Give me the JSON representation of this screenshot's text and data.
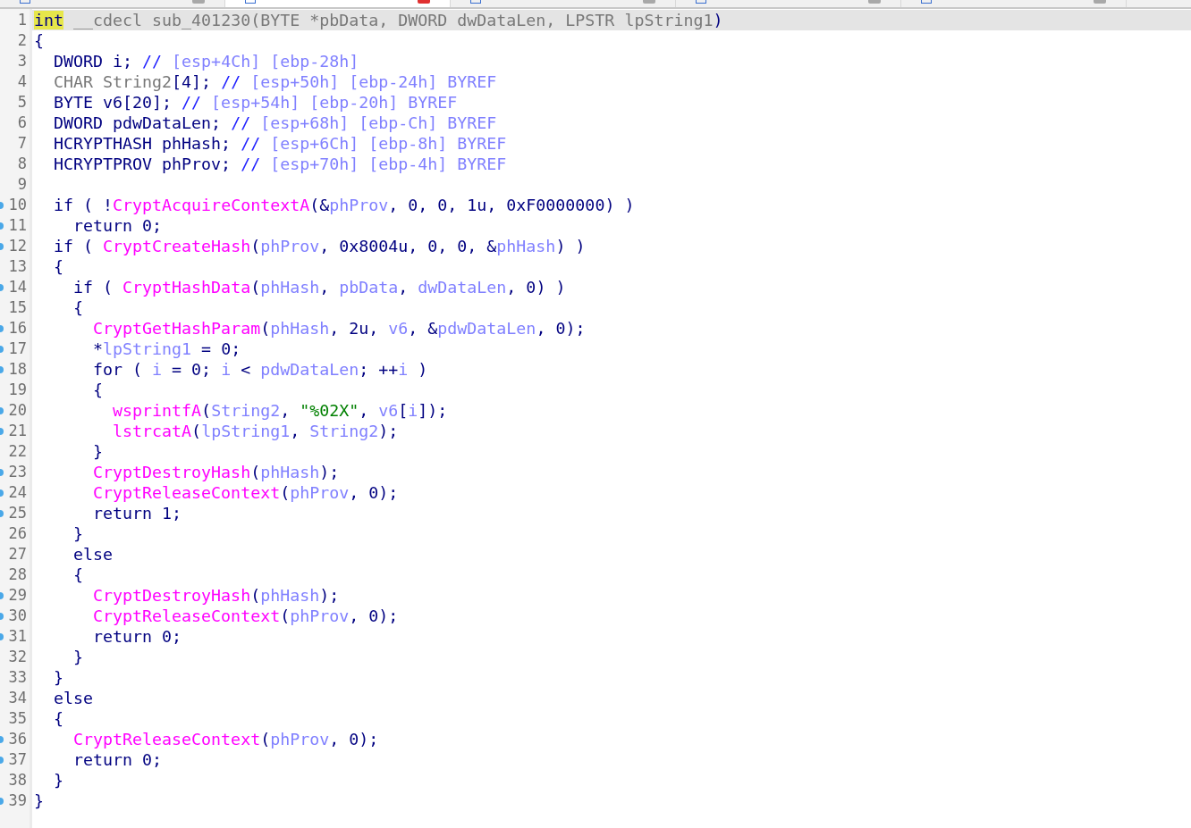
{
  "tabs": [
    {
      "selected": false
    },
    {
      "selected": true
    },
    {
      "selected": false
    },
    {
      "selected": false
    },
    {
      "selected": false
    }
  ],
  "lines": [
    {
      "number": "1",
      "marker": false,
      "selected": true,
      "tokens": [
        {
          "kind": "highlight",
          "text": "int"
        },
        {
          "kind": "dim",
          "text": " __cdecl sub_401230(BYTE *pbData, DWORD dwDataLen, LPSTR lpString1"
        },
        {
          "kind": "code",
          "text": ")"
        }
      ]
    },
    {
      "number": "2",
      "marker": false,
      "selected": false,
      "tokens": [
        {
          "kind": "code",
          "text": "{"
        }
      ]
    },
    {
      "number": "3",
      "marker": false,
      "selected": false,
      "tokens": [
        {
          "kind": "code",
          "text": "  DWORD i; "
        },
        {
          "kind": "comment",
          "text": "//"
        },
        {
          "kind": "var",
          "text": " [esp+4Ch] [ebp-28h]"
        }
      ]
    },
    {
      "number": "4",
      "marker": false,
      "selected": false,
      "tokens": [
        {
          "kind": "dim",
          "text": "  CHAR String2"
        },
        {
          "kind": "code",
          "text": "[4]; "
        },
        {
          "kind": "comment",
          "text": "//"
        },
        {
          "kind": "var",
          "text": " [esp+50h] [ebp-24h] BYREF"
        }
      ]
    },
    {
      "number": "5",
      "marker": false,
      "selected": false,
      "tokens": [
        {
          "kind": "code",
          "text": "  BYTE v6[20]; "
        },
        {
          "kind": "comment",
          "text": "//"
        },
        {
          "kind": "var",
          "text": " [esp+54h] [ebp-20h] BYREF"
        }
      ]
    },
    {
      "number": "6",
      "marker": false,
      "selected": false,
      "tokens": [
        {
          "kind": "code",
          "text": "  DWORD pdwDataLen; "
        },
        {
          "kind": "comment",
          "text": "//"
        },
        {
          "kind": "var",
          "text": " [esp+68h] [ebp-Ch] BYREF"
        }
      ]
    },
    {
      "number": "7",
      "marker": false,
      "selected": false,
      "tokens": [
        {
          "kind": "code",
          "text": "  HCRYPTHASH phHash; "
        },
        {
          "kind": "comment",
          "text": "//"
        },
        {
          "kind": "var",
          "text": " [esp+6Ch] [ebp-8h] BYREF"
        }
      ]
    },
    {
      "number": "8",
      "marker": false,
      "selected": false,
      "tokens": [
        {
          "kind": "code",
          "text": "  HCRYPTPROV phProv; "
        },
        {
          "kind": "comment",
          "text": "//"
        },
        {
          "kind": "var",
          "text": " [esp+70h] [ebp-4h] BYREF"
        }
      ]
    },
    {
      "number": "9",
      "marker": false,
      "selected": false
    },
    {
      "number": "10",
      "marker": true,
      "selected": false,
      "tokens": [
        {
          "kind": "code",
          "text": "  if ( !"
        },
        {
          "kind": "func",
          "text": "CryptAcquireContextA"
        },
        {
          "kind": "code",
          "text": "(&"
        },
        {
          "kind": "var",
          "text": "phProv"
        },
        {
          "kind": "code",
          "text": ", 0, 0, 1u, 0xF0000000) )"
        }
      ]
    },
    {
      "number": "11",
      "marker": true,
      "selected": false,
      "tokens": [
        {
          "kind": "code",
          "text": "    return 0;"
        }
      ]
    },
    {
      "number": "12",
      "marker": true,
      "selected": false,
      "tokens": [
        {
          "kind": "code",
          "text": "  if ( "
        },
        {
          "kind": "func",
          "text": "CryptCreateHash"
        },
        {
          "kind": "code",
          "text": "("
        },
        {
          "kind": "var",
          "text": "phProv"
        },
        {
          "kind": "code",
          "text": ", 0x8004u, 0, 0, &"
        },
        {
          "kind": "var",
          "text": "phHash"
        },
        {
          "kind": "code",
          "text": ") )"
        }
      ]
    },
    {
      "number": "13",
      "marker": false,
      "selected": false,
      "tokens": [
        {
          "kind": "code",
          "text": "  {"
        }
      ]
    },
    {
      "number": "14",
      "marker": true,
      "selected": false,
      "tokens": [
        {
          "kind": "code",
          "text": "    if ( "
        },
        {
          "kind": "func",
          "text": "CryptHashData"
        },
        {
          "kind": "code",
          "text": "("
        },
        {
          "kind": "var",
          "text": "phHash"
        },
        {
          "kind": "code",
          "text": ", "
        },
        {
          "kind": "var",
          "text": "pbData"
        },
        {
          "kind": "code",
          "text": ", "
        },
        {
          "kind": "var",
          "text": "dwDataLen"
        },
        {
          "kind": "code",
          "text": ", 0) )"
        }
      ]
    },
    {
      "number": "15",
      "marker": false,
      "selected": false,
      "tokens": [
        {
          "kind": "code",
          "text": "    {"
        }
      ]
    },
    {
      "number": "16",
      "marker": true,
      "selected": false,
      "tokens": [
        {
          "kind": "func",
          "text": "      CryptGetHashParam"
        },
        {
          "kind": "code",
          "text": "("
        },
        {
          "kind": "var",
          "text": "phHash"
        },
        {
          "kind": "code",
          "text": ", 2u, "
        },
        {
          "kind": "var",
          "text": "v6"
        },
        {
          "kind": "code",
          "text": ", &"
        },
        {
          "kind": "var",
          "text": "pdwDataLen"
        },
        {
          "kind": "code",
          "text": ", 0);"
        }
      ]
    },
    {
      "number": "17",
      "marker": true,
      "selected": false,
      "tokens": [
        {
          "kind": "code",
          "text": "      *"
        },
        {
          "kind": "var",
          "text": "lpString1"
        },
        {
          "kind": "code",
          "text": " = 0;"
        }
      ]
    },
    {
      "number": "18",
      "marker": true,
      "selected": false,
      "tokens": [
        {
          "kind": "code",
          "text": "      for ( "
        },
        {
          "kind": "var",
          "text": "i"
        },
        {
          "kind": "code",
          "text": " = 0; "
        },
        {
          "kind": "var",
          "text": "i"
        },
        {
          "kind": "code",
          "text": " < "
        },
        {
          "kind": "var",
          "text": "pdwDataLen"
        },
        {
          "kind": "code",
          "text": "; ++"
        },
        {
          "kind": "var",
          "text": "i"
        },
        {
          "kind": "code",
          "text": " )"
        }
      ]
    },
    {
      "number": "19",
      "marker": false,
      "selected": false,
      "tokens": [
        {
          "kind": "code",
          "text": "      {"
        }
      ]
    },
    {
      "number": "20",
      "marker": true,
      "selected": false,
      "tokens": [
        {
          "kind": "func",
          "text": "        wsprintfA"
        },
        {
          "kind": "code",
          "text": "("
        },
        {
          "kind": "var",
          "text": "String2"
        },
        {
          "kind": "code",
          "text": ", "
        },
        {
          "kind": "str",
          "text": "\"%02X\""
        },
        {
          "kind": "code",
          "text": ", "
        },
        {
          "kind": "var",
          "text": "v6"
        },
        {
          "kind": "code",
          "text": "["
        },
        {
          "kind": "var",
          "text": "i"
        },
        {
          "kind": "code",
          "text": "]);"
        }
      ]
    },
    {
      "number": "21",
      "marker": true,
      "selected": false,
      "tokens": [
        {
          "kind": "func",
          "text": "        lstrcatA"
        },
        {
          "kind": "code",
          "text": "("
        },
        {
          "kind": "var",
          "text": "lpString1"
        },
        {
          "kind": "code",
          "text": ", "
        },
        {
          "kind": "var",
          "text": "String2"
        },
        {
          "kind": "code",
          "text": ");"
        }
      ]
    },
    {
      "number": "22",
      "marker": false,
      "selected": false,
      "tokens": [
        {
          "kind": "code",
          "text": "      }"
        }
      ]
    },
    {
      "number": "23",
      "marker": true,
      "selected": false,
      "tokens": [
        {
          "kind": "func",
          "text": "      CryptDestroyHash"
        },
        {
          "kind": "code",
          "text": "("
        },
        {
          "kind": "var",
          "text": "phHash"
        },
        {
          "kind": "code",
          "text": ");"
        }
      ]
    },
    {
      "number": "24",
      "marker": true,
      "selected": false,
      "tokens": [
        {
          "kind": "func",
          "text": "      CryptReleaseContext"
        },
        {
          "kind": "code",
          "text": "("
        },
        {
          "kind": "var",
          "text": "phProv"
        },
        {
          "kind": "code",
          "text": ", 0);"
        }
      ]
    },
    {
      "number": "25",
      "marker": true,
      "selected": false,
      "tokens": [
        {
          "kind": "code",
          "text": "      return 1;"
        }
      ]
    },
    {
      "number": "26",
      "marker": false,
      "selected": false,
      "tokens": [
        {
          "kind": "code",
          "text": "    }"
        }
      ]
    },
    {
      "number": "27",
      "marker": false,
      "selected": false,
      "tokens": [
        {
          "kind": "code",
          "text": "    else"
        }
      ]
    },
    {
      "number": "28",
      "marker": false,
      "selected": false,
      "tokens": [
        {
          "kind": "code",
          "text": "    {"
        }
      ]
    },
    {
      "number": "29",
      "marker": true,
      "selected": false,
      "tokens": [
        {
          "kind": "func",
          "text": "      CryptDestroyHash"
        },
        {
          "kind": "code",
          "text": "("
        },
        {
          "kind": "var",
          "text": "phHash"
        },
        {
          "kind": "code",
          "text": ");"
        }
      ]
    },
    {
      "number": "30",
      "marker": true,
      "selected": false,
      "tokens": [
        {
          "kind": "func",
          "text": "      CryptReleaseContext"
        },
        {
          "kind": "code",
          "text": "("
        },
        {
          "kind": "var",
          "text": "phProv"
        },
        {
          "kind": "code",
          "text": ", 0);"
        }
      ]
    },
    {
      "number": "31",
      "marker": true,
      "selected": false,
      "tokens": [
        {
          "kind": "code",
          "text": "      return 0;"
        }
      ]
    },
    {
      "number": "32",
      "marker": false,
      "selected": false,
      "tokens": [
        {
          "kind": "code",
          "text": "    }"
        }
      ]
    },
    {
      "number": "33",
      "marker": false,
      "selected": false,
      "tokens": [
        {
          "kind": "code",
          "text": "  }"
        }
      ]
    },
    {
      "number": "34",
      "marker": false,
      "selected": false,
      "tokens": [
        {
          "kind": "code",
          "text": "  else"
        }
      ]
    },
    {
      "number": "35",
      "marker": false,
      "selected": false,
      "tokens": [
        {
          "kind": "code",
          "text": "  {"
        }
      ]
    },
    {
      "number": "36",
      "marker": true,
      "selected": false,
      "tokens": [
        {
          "kind": "func",
          "text": "    CryptReleaseContext"
        },
        {
          "kind": "code",
          "text": "("
        },
        {
          "kind": "var",
          "text": "phProv"
        },
        {
          "kind": "code",
          "text": ", 0);"
        }
      ]
    },
    {
      "number": "37",
      "marker": true,
      "selected": false,
      "tokens": [
        {
          "kind": "code",
          "text": "    return 0;"
        }
      ]
    },
    {
      "number": "38",
      "marker": false,
      "selected": false,
      "tokens": [
        {
          "kind": "code",
          "text": "  }"
        }
      ]
    },
    {
      "number": "39",
      "marker": true,
      "selected": false,
      "tokens": [
        {
          "kind": "code",
          "text": "}"
        }
      ]
    }
  ]
}
